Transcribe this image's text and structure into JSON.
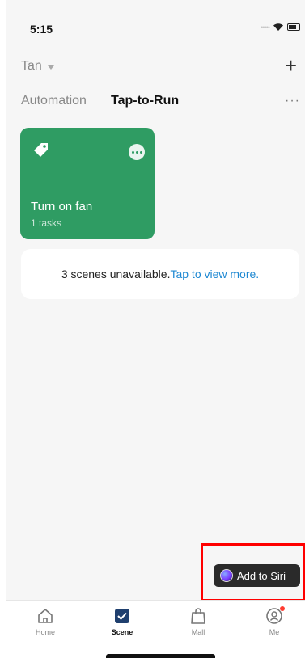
{
  "status_bar": {
    "time": "5:15"
  },
  "header": {
    "home_name": "Tan",
    "add_symbol": "+"
  },
  "tabs": {
    "automation": "Automation",
    "tap_to_run": "Tap-to-Run",
    "more": "···"
  },
  "scene_card": {
    "title": "Turn on fan",
    "subtitle": "1 tasks",
    "color": "#2f9c63"
  },
  "notice": {
    "text": "3 scenes unavailable.",
    "link": "Tap to view more."
  },
  "siri": {
    "label": "Add to Siri"
  },
  "tab_bar": {
    "items": [
      {
        "label": "Home",
        "icon": "home-icon"
      },
      {
        "label": "Scene",
        "icon": "scene-check-icon"
      },
      {
        "label": "Mall",
        "icon": "shopping-bag-icon"
      },
      {
        "label": "Me",
        "icon": "profile-icon"
      }
    ]
  },
  "colors": {
    "accent": "#1e88d2",
    "card": "#2f9c63",
    "highlight": "#ff0000"
  }
}
